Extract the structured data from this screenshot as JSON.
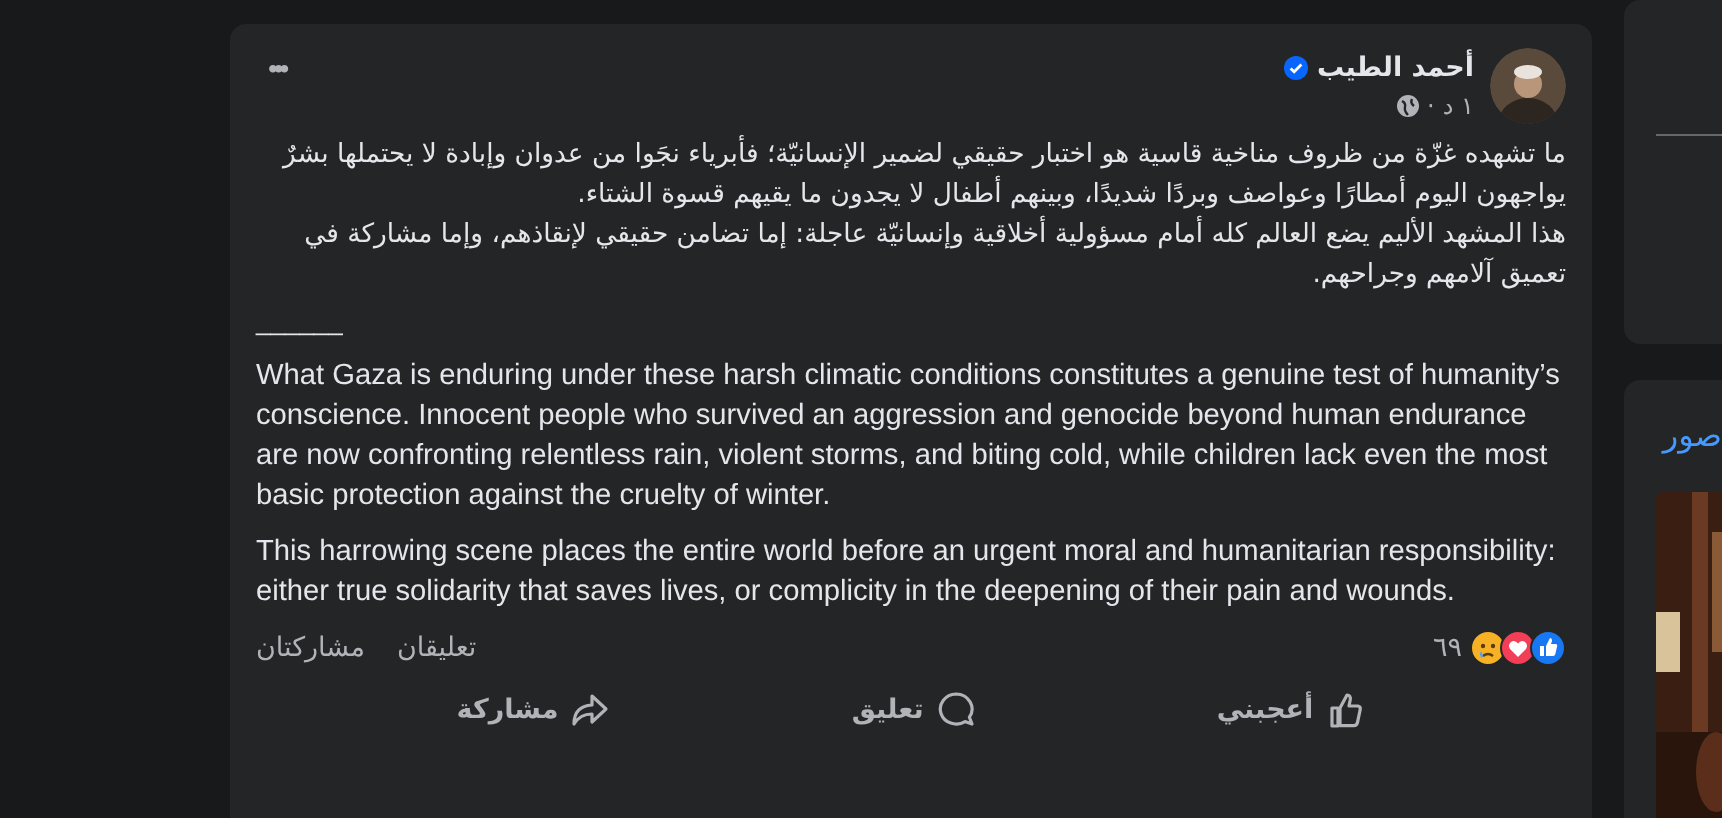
{
  "post": {
    "author": {
      "name": "أحمد الطيب",
      "verified": true
    },
    "time": "١ د",
    "time_separator": "·",
    "menu": "•••",
    "text_ar": [
      "ما تشهده غزّة من ظروف مناخية قاسية هو اختبار حقيقي لضمير الإنسانيّة؛ فأبرياء نجَوا من عدوان وإبادة لا يحتملها بشرٌ يواجهون اليوم أمطارًا وعواصف وبردًا شديدًا، وبينهم أطفال لا يجدون ما يقيهم قسوة الشتاء.",
      "هذا المشهد الأليم يضع العالم كله أمام مسؤولية أخلاقية وإنسانيّة عاجلة: إما تضامن حقيقي لإنقاذهم، وإما مشاركة في تعميق آلامهم وجراحهم."
    ],
    "separator": "______",
    "text_en": [
      "What Gaza is enduring under these harsh climatic conditions constitutes a genuine test of humanity’s conscience. Innocent people who survived an aggression and genocide beyond human endurance are now confronting relentless rain, violent storms, and biting cold, while children lack even the most basic protection against the cruelty of winter.",
      "This harrowing scene places the entire world before an urgent moral and humanitarian responsibility: either true solidarity that saves lives, or complicity in the deepening of their pain and wounds."
    ],
    "reactions": [
      {
        "kind": "like"
      },
      {
        "kind": "love"
      },
      {
        "kind": "sad"
      }
    ],
    "reaction_count": "٦٩",
    "comments": "تعليقان",
    "shares": "مشاركتان",
    "actions": [
      {
        "kind": "like",
        "label": "أعجبني"
      },
      {
        "kind": "comment",
        "label": "تعليق"
      },
      {
        "kind": "share",
        "label": "مشاركة"
      }
    ]
  },
  "sidebar": {
    "photos_title": "صور"
  }
}
